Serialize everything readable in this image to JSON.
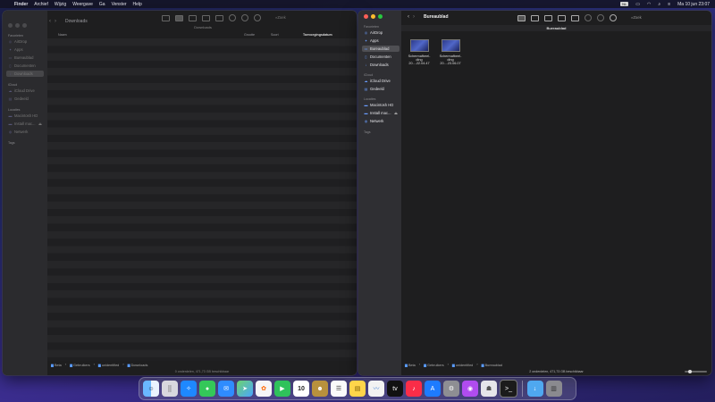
{
  "menubar": {
    "items": [
      "Finder",
      "Archief",
      "Wijzig",
      "Weergave",
      "Ga",
      "Venster",
      "Help"
    ],
    "input_badge": "NL",
    "clock": "Ma 10 jun  23:07"
  },
  "win_left": {
    "title": "Downloads",
    "path_strip": "Downloads",
    "search_placeholder": "Zoek",
    "sections": {
      "favorites": "Favorieten",
      "icloud": "iCloud",
      "locations": "Locaties",
      "tags": "Tags"
    },
    "sidebar": [
      "AirDrop",
      "Apps",
      "Bureaublad",
      "Documenten",
      "Downloads"
    ],
    "sidebar_icloud": [
      "iCloud Drive",
      "Gedeeld"
    ],
    "sidebar_locations": [
      "Macintosh HD",
      "Install mac...",
      "Netwerk"
    ],
    "columns": [
      "Naam",
      "Grootte",
      "Soort",
      "Toevoegingsdatum"
    ],
    "path": [
      "Beta",
      "Gebruikers",
      "unidentified",
      "Downloads"
    ],
    "status": "0 onderdelen, 471,73 GB beschikbaar"
  },
  "win_right": {
    "title": "Bureaublad",
    "path_strip": "Bureaublad",
    "search_placeholder": "Zoek",
    "sections": {
      "favorites": "Favorieten",
      "icloud": "iCloud",
      "locations": "Locaties",
      "tags": "Tags"
    },
    "sidebar": [
      "AirDrop",
      "Apps",
      "Bureaublad",
      "Documenten",
      "Downloads"
    ],
    "sidebar_icloud": [
      "iCloud Drive",
      "Gedeeld"
    ],
    "sidebar_locations": [
      "Macintosh HD",
      "Install mac...",
      "Netwerk"
    ],
    "files": [
      {
        "line1": "Schermafbeel-",
        "line2": "ding 20....22.04.47"
      },
      {
        "line1": "Schermafbeel-",
        "line2": "ding 20....23.06.07"
      }
    ],
    "path": [
      "Beta",
      "Gebruikers",
      "unidentified",
      "Bureaublad"
    ],
    "status": "2 onderdelen, 471,73 GB beschikbaar"
  },
  "dock": {
    "calendar_day": "10"
  }
}
